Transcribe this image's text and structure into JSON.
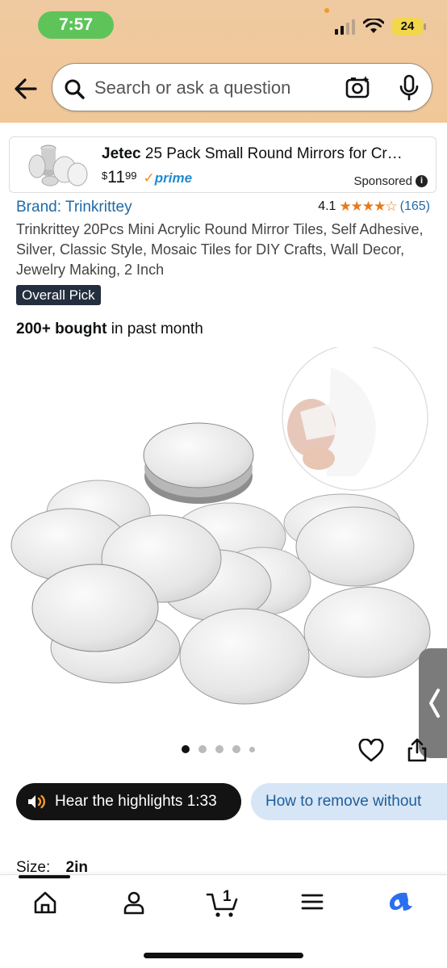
{
  "status": {
    "time": "7:57",
    "battery": "24"
  },
  "search": {
    "placeholder": "Search or ask a question"
  },
  "ad": {
    "brand": "Jetec",
    "title_rest": " 25 Pack Small Round Mirrors for Cr…",
    "price_symbol": "$",
    "price_whole": "11",
    "price_fraction": "99",
    "prime_label": "prime",
    "sponsored_label": "Sponsored"
  },
  "product": {
    "brand": "Brand: Trinkrittey",
    "rating": "4.1",
    "stars": "★★★★☆",
    "rating_count": "(165)",
    "title": "Trinkrittey 20Pcs Mini Acrylic Round Mirror Tiles, Self Adhesive, Silver, Classic Style, Mosaic Tiles for DIY Crafts, Wall Decor, Jewelry Making, 2 Inch",
    "badge": "Overall Pick",
    "bought_bold": "200+ bought",
    "bought_rest": " in past month",
    "image_count": 5,
    "active_image": 1
  },
  "actions": {
    "hear_label": "Hear the highlights 1:33",
    "howto_label": "How to remove without"
  },
  "size": {
    "label": "Size:",
    "value": "2in"
  },
  "nav": {
    "cart_count": "1"
  }
}
